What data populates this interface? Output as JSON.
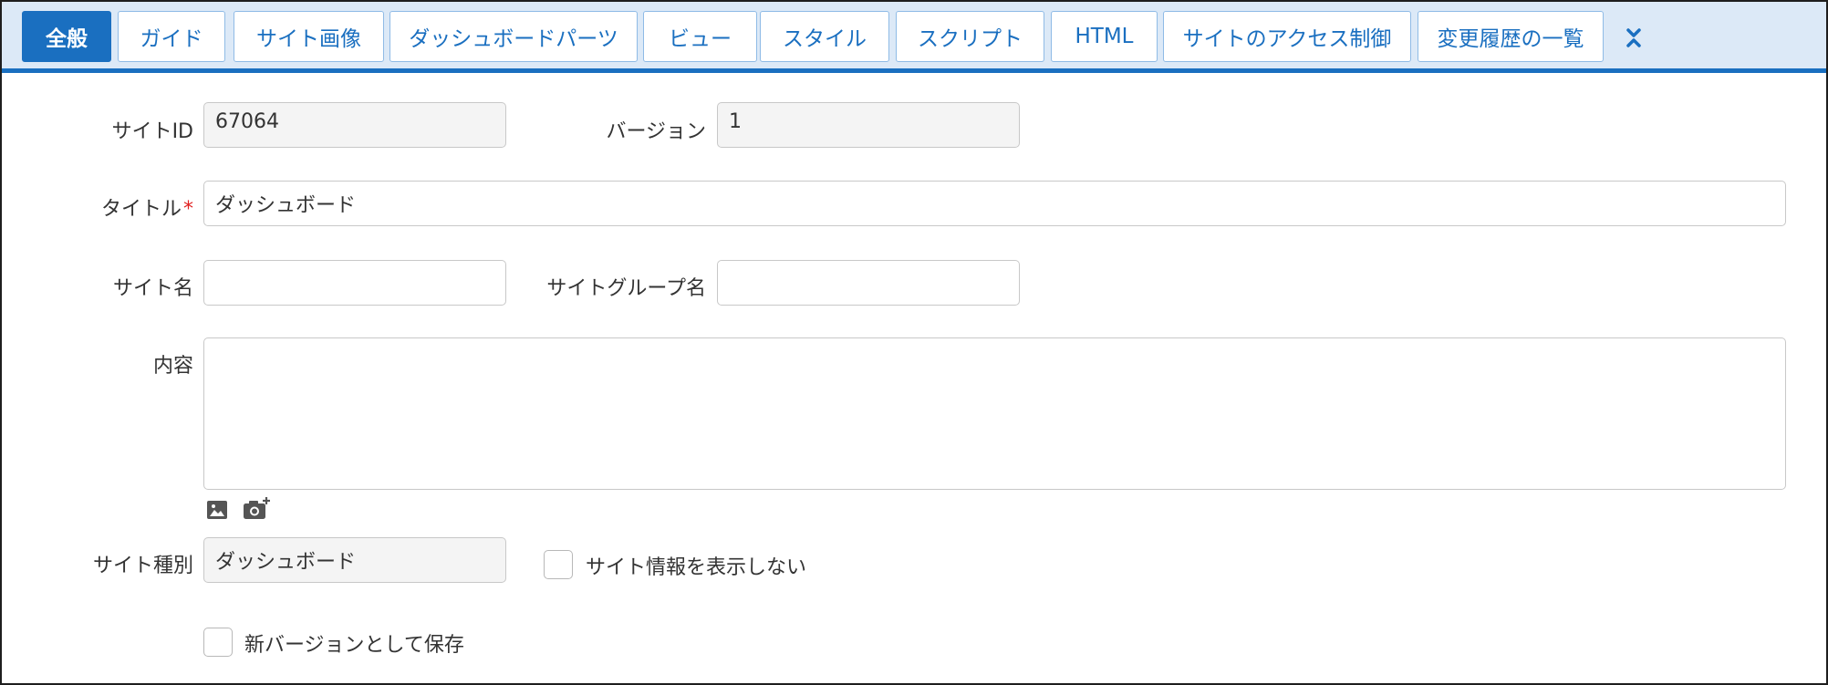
{
  "tabs": [
    {
      "label": "全般",
      "active": true
    },
    {
      "label": "ガイド"
    },
    {
      "label": "サイト画像"
    },
    {
      "label": "ダッシュボードパーツ"
    },
    {
      "label": "ビュー"
    },
    {
      "label": "スタイル"
    },
    {
      "label": "スクリプト"
    },
    {
      "label": "HTML"
    },
    {
      "label": "サイトのアクセス制御"
    },
    {
      "label": "変更履歴の一覧"
    }
  ],
  "colors": {
    "accent": "#1a6fc0",
    "tabbar_bg": "#dce9f7",
    "required": "#e02020"
  },
  "form": {
    "site_id": {
      "label": "サイトID",
      "value": "67064"
    },
    "version": {
      "label": "バージョン",
      "value": "1"
    },
    "title": {
      "label": "タイトル",
      "required_mark": "*",
      "value": "ダッシュボード"
    },
    "site_name": {
      "label": "サイト名",
      "value": ""
    },
    "site_group_name": {
      "label": "サイトグループ名",
      "value": ""
    },
    "body": {
      "label": "内容",
      "value": ""
    },
    "site_type": {
      "label": "サイト種別",
      "value": "ダッシュボード"
    },
    "hide_site_info": {
      "label": "サイト情報を表示しない",
      "checked": false
    },
    "save_as_new_version": {
      "label": "新バージョンとして保存",
      "checked": false
    }
  },
  "icons": {
    "toggle": "chevrons-up-down-icon",
    "image": "image-icon",
    "camera": "camera-add-icon"
  }
}
